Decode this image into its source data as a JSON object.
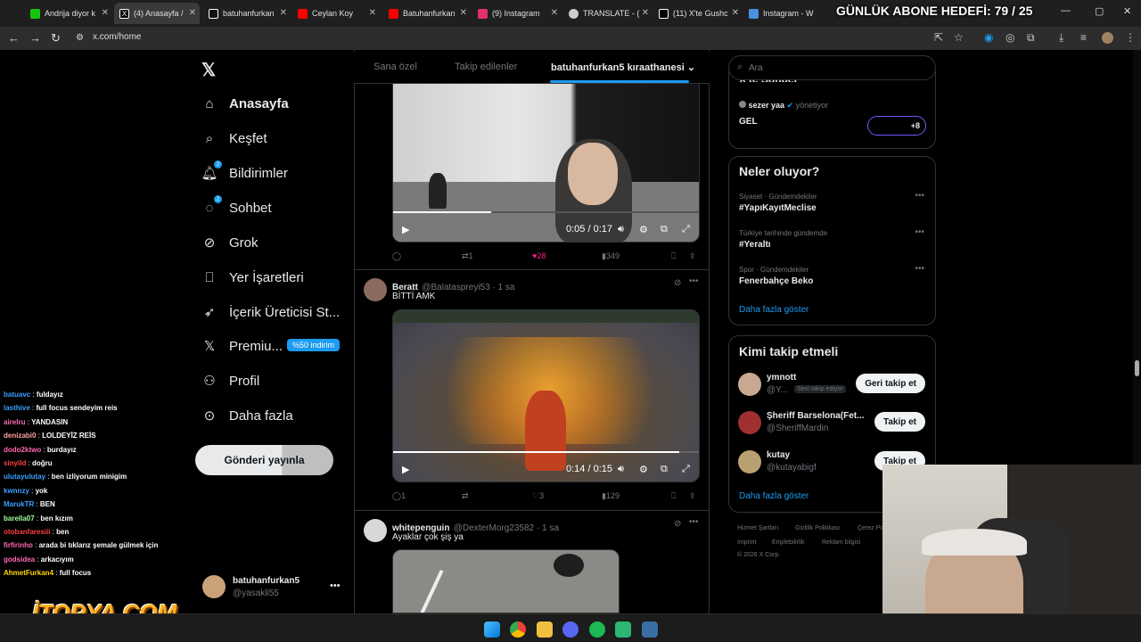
{
  "browser": {
    "tabs": [
      {
        "title": "Andrija diyor k",
        "color": "#16c60c"
      },
      {
        "title": "(4) Anasayfa / ",
        "color": "#ffffff"
      },
      {
        "title": "batuhanfurkan",
        "color": "#ffffff"
      },
      {
        "title": "Ceylan Koy",
        "color": "#ff0000"
      },
      {
        "title": "Batuhanfurkan",
        "color": "#ff0000"
      },
      {
        "title": "(9) Instagram",
        "color": "#e1306c"
      },
      {
        "title": "TRANSLATE - (",
        "color": "#cccccc"
      },
      {
        "title": "(11) X'te Gushc",
        "color": "#ffffff"
      },
      {
        "title": "Instagram - W",
        "color": "#4a90e2"
      }
    ],
    "url": "x.com/home",
    "overlay_goal": "GÜNLÜK ABONE HEDEFİ: 79 / 25"
  },
  "sidebar": {
    "items": [
      {
        "label": "Anasayfa",
        "icon": "home-icon",
        "bold": true
      },
      {
        "label": "Keşfet",
        "icon": "search-icon"
      },
      {
        "label": "Bildirimler",
        "icon": "bell-icon",
        "badge": "2"
      },
      {
        "label": "Sohbet",
        "icon": "chat-icon",
        "badge": "2"
      },
      {
        "label": "Grok",
        "icon": "grok-icon"
      },
      {
        "label": "Yer İşaretleri",
        "icon": "bookmark-icon"
      },
      {
        "label": "İçerik Üreticisi St...",
        "icon": "rocket-icon"
      },
      {
        "label": "Premiu...",
        "icon": "x-logo-icon"
      },
      {
        "label": "Profil",
        "icon": "person-icon"
      },
      {
        "label": "Daha fazla",
        "icon": "more-circle-icon"
      }
    ],
    "premium_badge": "%50 indirim",
    "post_button": "Gönderi yayınla",
    "account": {
      "name": "batuhanfurkan5",
      "handle": "@yasakli55"
    }
  },
  "feed": {
    "tabs": [
      "Sana özel",
      "Takip edilenler",
      "batuhanfurkan5 kıraathanesi"
    ],
    "posts": [
      {
        "video_time": "0:05 / 0:17",
        "actions": {
          "replies": "",
          "reposts": "1",
          "likes": "28",
          "views": "349"
        }
      },
      {
        "name": "Beratt",
        "handle": "@Balataspreyi53 · 1 sa",
        "text": "BİTTİ AMK",
        "video_time": "0:14 / 0:15",
        "actions": {
          "replies": "1",
          "reposts": "",
          "likes": "3",
          "views": "129"
        }
      },
      {
        "name": "whitepenguin",
        "handle": "@DexterMorg23582 · 1 sa",
        "text": "Ayaklar çok şiş ya"
      }
    ]
  },
  "right": {
    "search_placeholder": "Ara",
    "community": {
      "title": "X'te Sohbet",
      "manager_name": "sezer yaa",
      "manager_role": "yönetiyor",
      "name": "GEL",
      "extra": "+8"
    },
    "trends_title": "Neler oluyor?",
    "trends": [
      {
        "category": "Siyaset · Gündemdekiler",
        "name": "#YapıKayıtMeclise"
      },
      {
        "category": "Türkiye tarihinde gündemde",
        "name": "#Yeraltı"
      },
      {
        "category": "Spor · Gündemdekiler",
        "name": "Fenerbahçe Beko"
      }
    ],
    "show_more": "Daha fazla göster",
    "who_title": "Kimi takip etmeli",
    "suggestions": [
      {
        "name": "ymnott",
        "handle": "@Y...",
        "tag": "Seni takip ediyor",
        "button": "Geri takip et"
      },
      {
        "name": "Şheriff Barselona(Fet...",
        "handle": "@SheriffMardin",
        "button": "Takip et"
      },
      {
        "name": "kutay",
        "handle": "@kutayabigf",
        "button": "Takip et"
      }
    ],
    "footer": [
      "Hizmet Şartları",
      "Gizlilik Politikası",
      "Çerez Po",
      "Imprint",
      "Erişilebilirlik",
      "Reklam bilgisi",
      "© 2026 X Corp."
    ]
  },
  "chat": [
    {
      "user": "batuavc",
      "color": "#3aa0ff",
      "msg": "fuldayız"
    },
    {
      "user": "lasthive",
      "color": "#3aa0ff",
      "msg": "full focus sendeyim reis"
    },
    {
      "user": "airelru",
      "color": "#ff69b4",
      "msg": "YANDASIN"
    },
    {
      "user": "denizabi0",
      "color": "#ffa0a0",
      "msg": "LOLDEYİZ REİS"
    },
    {
      "user": "dodo2ktwo",
      "color": "#ff69b4",
      "msg": "burdayız"
    },
    {
      "user": "sinyild",
      "color": "#ff4040",
      "msg": "doğru"
    },
    {
      "user": "ulutayulutay",
      "color": "#3aa0ff",
      "msg": "ben izliyorum minigim"
    },
    {
      "user": "kwnnzy",
      "color": "#3aa0ff",
      "msg": "yok"
    },
    {
      "user": "MarukTR",
      "color": "#3aa0ff",
      "msg": "BEN"
    },
    {
      "user": "barella07",
      "color": "#a0ffa0",
      "msg": "ben kızım"
    },
    {
      "user": "otobanfaresiii",
      "color": "#ff4040",
      "msg": "ben"
    },
    {
      "user": "firfirinho",
      "color": "#ff69b4",
      "msg": "arada bi tıklarız şemale gülmek için"
    },
    {
      "user": "godsidea",
      "color": "#ff69b4",
      "msg": "arkacıyım"
    },
    {
      "user": "AhmetFurkan4",
      "color": "#ffd700",
      "msg": "full focus"
    }
  ],
  "sponsor": "İTOPYA.COM"
}
